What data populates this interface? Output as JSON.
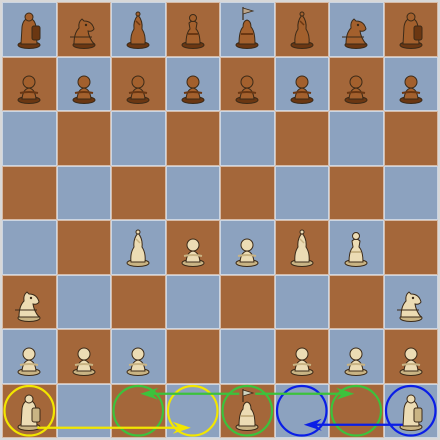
{
  "board": {
    "colors": {
      "light_square": "#8ca2bf",
      "dark_square": "#a4673a",
      "white_piece": "#ecdcb4",
      "white_piece_shade": "#c9b484",
      "black_piece": "#a3602d",
      "black_piece_shade": "#6b3712",
      "outline": "#3b2a18"
    },
    "rows": [
      [
        "bR",
        "bN",
        "bB",
        "bQ",
        "bK",
        "bB",
        "bN",
        "bR"
      ],
      [
        "bP",
        "bP",
        "bP",
        "bP",
        "bP",
        "bP",
        "bP",
        "bP"
      ],
      [
        "",
        "",
        "",
        "",
        "",
        "",
        "",
        ""
      ],
      [
        "",
        "",
        "",
        "",
        "",
        "",
        "",
        ""
      ],
      [
        "",
        "",
        "wB",
        "wP",
        "wP",
        "wB",
        "wQ",
        ""
      ],
      [
        "wN",
        "",
        "",
        "",
        "",
        "",
        "",
        "wN"
      ],
      [
        "wP",
        "wP",
        "wP",
        "",
        "",
        "wP",
        "wP",
        "wP"
      ],
      [
        "wR",
        "",
        "",
        "",
        "wK",
        "",
        "",
        "wR"
      ]
    ]
  },
  "annotations": {
    "circles": [
      {
        "square": "a1",
        "color": "#f2e600"
      },
      {
        "square": "d1",
        "color": "#f2e600"
      },
      {
        "square": "c1",
        "color": "#3cc23c"
      },
      {
        "square": "e1",
        "color": "#3cc23c"
      },
      {
        "square": "g1",
        "color": "#3cc23c"
      },
      {
        "square": "f1",
        "color": "#0a1ee6"
      },
      {
        "square": "h1",
        "color": "#0a1ee6"
      }
    ],
    "arrows": [
      {
        "from": "a1",
        "to": "d1",
        "color": "#f2e600"
      },
      {
        "from": "e1",
        "to": "c1",
        "color": "#3cc23c"
      },
      {
        "from": "e1",
        "to": "g1",
        "color": "#3cc23c"
      },
      {
        "from": "h1",
        "to": "f1",
        "color": "#0a1ee6"
      }
    ]
  }
}
